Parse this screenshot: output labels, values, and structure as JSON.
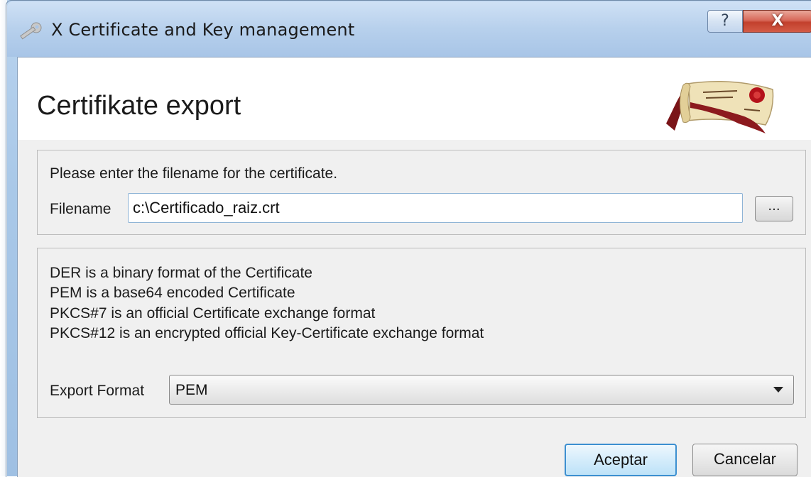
{
  "window": {
    "title": "X Certificate and Key management",
    "help_label": "?",
    "close_label": "X"
  },
  "page": {
    "heading": "Certifikate export"
  },
  "file_group": {
    "prompt": "Please enter the filename for the certificate.",
    "filename_label": "Filename",
    "filename_value": "c:\\Certificado_raiz.crt",
    "browse_label": "..."
  },
  "format_group": {
    "descriptions": [
      "DER is a binary format of the Certificate",
      "PEM is a base64 encoded Certificate",
      "PKCS#7 is an official Certificate exchange format",
      "PKCS#12 is an encrypted official Key-Certificate exchange format"
    ],
    "export_format_label": "Export Format",
    "export_format_value": "PEM"
  },
  "buttons": {
    "ok_label": "Aceptar",
    "cancel_label": "Cancelar"
  },
  "colors": {
    "titlebar": "#b7d0ec",
    "close_button": "#c2402d",
    "default_button_border": "#3c8fd0"
  }
}
